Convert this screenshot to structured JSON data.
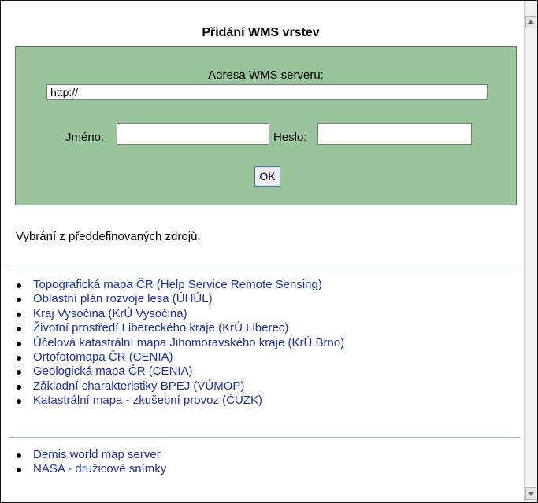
{
  "dialog": {
    "title": "Přidání WMS vrstev"
  },
  "form": {
    "url_label": "Adresa WMS serveru:",
    "url_value": "http://",
    "name_label": "Jméno:",
    "name_value": "",
    "password_label": "Heslo:",
    "password_value": "",
    "ok_label": "OK"
  },
  "predefined": {
    "intro": "Vybrání z předdefinovaných zdrojů:",
    "group1": [
      "Topografická mapa ČR (Help Service Remote Sensing)",
      "Oblastní plán rozvoje lesa (ÚHÚL)",
      "Kraj Vysočina (KrÚ Vysočina)",
      "Životní prostředí Libereckého kraje (KrÚ Liberec)",
      "Účelová katastrální mapa Jihomoravského kraje (KrÚ Brno)",
      "Ortofotomapa ČR (CENIA)",
      "Geologická mapa ČR (CENIA)",
      "Základní charakteristiky BPEJ (VÚMOP)",
      "Katastrální mapa - zkušební provoz (ČÚZK)"
    ],
    "group2": [
      "Demis world map server",
      "NASA - družicové snímky"
    ]
  },
  "colors": {
    "panel_bg": "#9ac49c",
    "link": "#1a2fa6",
    "separator": "#9ec9a0"
  }
}
